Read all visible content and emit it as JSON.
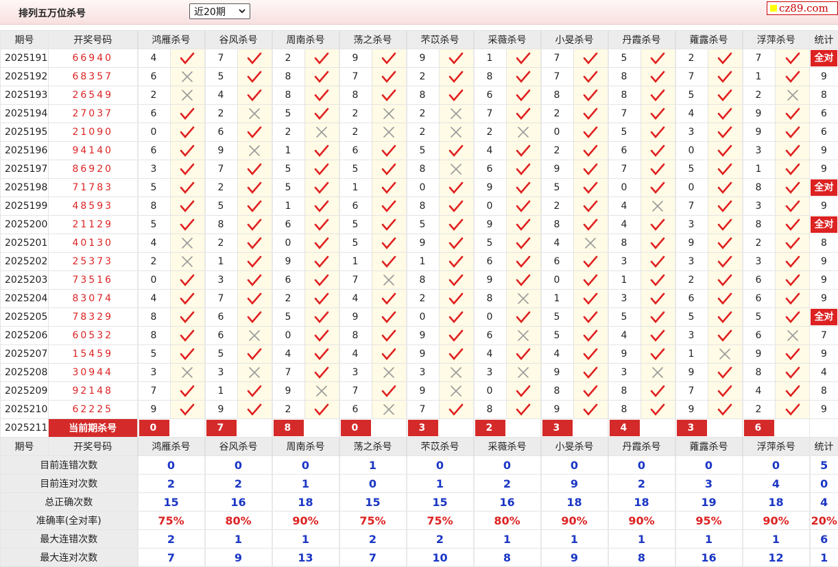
{
  "header": {
    "title": "排列五万位杀号",
    "period_select": "近20期",
    "logo": "cz89.com"
  },
  "columns": {
    "period": "期号",
    "number": "开奖号码",
    "experts": [
      "鸿雁杀号",
      "谷风杀号",
      "周南杀号",
      "荡之杀号",
      "芣苡杀号",
      "采薇杀号",
      "小旻杀号",
      "丹霞杀号",
      "蕹露杀号",
      "浮萍杀号"
    ],
    "stat": "统计"
  },
  "rows": [
    {
      "period": "2025191",
      "number": "66940",
      "kills": [
        [
          4,
          1
        ],
        [
          7,
          1
        ],
        [
          2,
          1
        ],
        [
          9,
          1
        ],
        [
          9,
          1
        ],
        [
          1,
          1
        ],
        [
          7,
          1
        ],
        [
          5,
          1
        ],
        [
          2,
          1
        ],
        [
          7,
          1
        ]
      ],
      "stat": "全对"
    },
    {
      "period": "2025192",
      "number": "68357",
      "kills": [
        [
          6,
          0
        ],
        [
          5,
          1
        ],
        [
          8,
          1
        ],
        [
          7,
          1
        ],
        [
          2,
          1
        ],
        [
          8,
          1
        ],
        [
          7,
          1
        ],
        [
          8,
          1
        ],
        [
          7,
          1
        ],
        [
          1,
          1
        ]
      ],
      "stat": "9"
    },
    {
      "period": "2025193",
      "number": "26549",
      "kills": [
        [
          2,
          0
        ],
        [
          4,
          1
        ],
        [
          8,
          1
        ],
        [
          8,
          1
        ],
        [
          8,
          1
        ],
        [
          6,
          1
        ],
        [
          8,
          1
        ],
        [
          8,
          1
        ],
        [
          5,
          1
        ],
        [
          2,
          0
        ]
      ],
      "stat": "8"
    },
    {
      "period": "2025194",
      "number": "27037",
      "kills": [
        [
          6,
          1
        ],
        [
          2,
          0
        ],
        [
          5,
          1
        ],
        [
          2,
          0
        ],
        [
          2,
          0
        ],
        [
          7,
          1
        ],
        [
          2,
          1
        ],
        [
          7,
          1
        ],
        [
          4,
          1
        ],
        [
          9,
          1
        ]
      ],
      "stat": "6"
    },
    {
      "period": "2025195",
      "number": "21090",
      "kills": [
        [
          0,
          1
        ],
        [
          6,
          1
        ],
        [
          2,
          0
        ],
        [
          2,
          0
        ],
        [
          2,
          0
        ],
        [
          2,
          0
        ],
        [
          0,
          1
        ],
        [
          5,
          1
        ],
        [
          3,
          1
        ],
        [
          9,
          1
        ]
      ],
      "stat": "6"
    },
    {
      "period": "2025196",
      "number": "94140",
      "kills": [
        [
          6,
          1
        ],
        [
          9,
          0
        ],
        [
          1,
          1
        ],
        [
          6,
          1
        ],
        [
          5,
          1
        ],
        [
          4,
          1
        ],
        [
          2,
          1
        ],
        [
          6,
          1
        ],
        [
          0,
          1
        ],
        [
          3,
          1
        ]
      ],
      "stat": "9"
    },
    {
      "period": "2025197",
      "number": "86920",
      "kills": [
        [
          3,
          1
        ],
        [
          7,
          1
        ],
        [
          5,
          1
        ],
        [
          5,
          1
        ],
        [
          8,
          0
        ],
        [
          6,
          1
        ],
        [
          9,
          1
        ],
        [
          7,
          1
        ],
        [
          5,
          1
        ],
        [
          1,
          1
        ]
      ],
      "stat": "9"
    },
    {
      "period": "2025198",
      "number": "71783",
      "kills": [
        [
          5,
          1
        ],
        [
          2,
          1
        ],
        [
          5,
          1
        ],
        [
          1,
          1
        ],
        [
          0,
          1
        ],
        [
          9,
          1
        ],
        [
          5,
          1
        ],
        [
          0,
          1
        ],
        [
          0,
          1
        ],
        [
          8,
          1
        ]
      ],
      "stat": "全对"
    },
    {
      "period": "2025199",
      "number": "48593",
      "kills": [
        [
          8,
          1
        ],
        [
          5,
          1
        ],
        [
          1,
          1
        ],
        [
          6,
          1
        ],
        [
          8,
          1
        ],
        [
          0,
          1
        ],
        [
          2,
          1
        ],
        [
          4,
          0
        ],
        [
          7,
          1
        ],
        [
          3,
          1
        ]
      ],
      "stat": "9"
    },
    {
      "period": "2025200",
      "number": "21129",
      "kills": [
        [
          5,
          1
        ],
        [
          8,
          1
        ],
        [
          6,
          1
        ],
        [
          5,
          1
        ],
        [
          5,
          1
        ],
        [
          9,
          1
        ],
        [
          8,
          1
        ],
        [
          4,
          1
        ],
        [
          3,
          1
        ],
        [
          8,
          1
        ]
      ],
      "stat": "全对"
    },
    {
      "period": "2025201",
      "number": "40130",
      "kills": [
        [
          4,
          0
        ],
        [
          2,
          1
        ],
        [
          0,
          1
        ],
        [
          5,
          1
        ],
        [
          9,
          1
        ],
        [
          5,
          1
        ],
        [
          4,
          0
        ],
        [
          8,
          1
        ],
        [
          9,
          1
        ],
        [
          2,
          1
        ]
      ],
      "stat": "8"
    },
    {
      "period": "2025202",
      "number": "25373",
      "kills": [
        [
          2,
          0
        ],
        [
          1,
          1
        ],
        [
          9,
          1
        ],
        [
          1,
          1
        ],
        [
          1,
          1
        ],
        [
          6,
          1
        ],
        [
          6,
          1
        ],
        [
          3,
          1
        ],
        [
          3,
          1
        ],
        [
          3,
          1
        ]
      ],
      "stat": "9"
    },
    {
      "period": "2025203",
      "number": "73516",
      "kills": [
        [
          0,
          1
        ],
        [
          3,
          1
        ],
        [
          6,
          1
        ],
        [
          7,
          0
        ],
        [
          8,
          1
        ],
        [
          9,
          1
        ],
        [
          0,
          1
        ],
        [
          1,
          1
        ],
        [
          2,
          1
        ],
        [
          6,
          1
        ]
      ],
      "stat": "9"
    },
    {
      "period": "2025204",
      "number": "83074",
      "kills": [
        [
          4,
          1
        ],
        [
          7,
          1
        ],
        [
          2,
          1
        ],
        [
          4,
          1
        ],
        [
          2,
          1
        ],
        [
          8,
          0
        ],
        [
          1,
          1
        ],
        [
          3,
          1
        ],
        [
          6,
          1
        ],
        [
          6,
          1
        ]
      ],
      "stat": "9"
    },
    {
      "period": "2025205",
      "number": "78329",
      "kills": [
        [
          8,
          1
        ],
        [
          6,
          1
        ],
        [
          5,
          1
        ],
        [
          9,
          1
        ],
        [
          0,
          1
        ],
        [
          0,
          1
        ],
        [
          5,
          1
        ],
        [
          5,
          1
        ],
        [
          5,
          1
        ],
        [
          5,
          1
        ]
      ],
      "stat": "全对"
    },
    {
      "period": "2025206",
      "number": "60532",
      "kills": [
        [
          8,
          1
        ],
        [
          6,
          0
        ],
        [
          0,
          1
        ],
        [
          8,
          1
        ],
        [
          9,
          1
        ],
        [
          6,
          0
        ],
        [
          5,
          1
        ],
        [
          4,
          1
        ],
        [
          3,
          1
        ],
        [
          6,
          0
        ]
      ],
      "stat": "7"
    },
    {
      "period": "2025207",
      "number": "15459",
      "kills": [
        [
          5,
          1
        ],
        [
          5,
          1
        ],
        [
          4,
          1
        ],
        [
          4,
          1
        ],
        [
          9,
          1
        ],
        [
          4,
          1
        ],
        [
          4,
          1
        ],
        [
          9,
          1
        ],
        [
          1,
          0
        ],
        [
          9,
          1
        ]
      ],
      "stat": "9"
    },
    {
      "period": "2025208",
      "number": "30944",
      "kills": [
        [
          3,
          0
        ],
        [
          3,
          0
        ],
        [
          7,
          1
        ],
        [
          3,
          0
        ],
        [
          3,
          0
        ],
        [
          3,
          0
        ],
        [
          9,
          1
        ],
        [
          3,
          0
        ],
        [
          9,
          1
        ],
        [
          8,
          1
        ]
      ],
      "stat": "4"
    },
    {
      "period": "2025209",
      "number": "92148",
      "kills": [
        [
          7,
          1
        ],
        [
          1,
          1
        ],
        [
          9,
          0
        ],
        [
          7,
          1
        ],
        [
          9,
          0
        ],
        [
          0,
          1
        ],
        [
          8,
          1
        ],
        [
          8,
          1
        ],
        [
          7,
          1
        ],
        [
          4,
          1
        ]
      ],
      "stat": "8"
    },
    {
      "period": "2025210",
      "number": "62225",
      "kills": [
        [
          9,
          1
        ],
        [
          9,
          1
        ],
        [
          2,
          1
        ],
        [
          6,
          0
        ],
        [
          7,
          1
        ],
        [
          8,
          1
        ],
        [
          9,
          1
        ],
        [
          8,
          1
        ],
        [
          9,
          1
        ],
        [
          2,
          1
        ]
      ],
      "stat": "9"
    }
  ],
  "current": {
    "period": "2025211",
    "label": "当前期杀号",
    "kills": [
      "0",
      "7",
      "8",
      "0",
      "3",
      "2",
      "3",
      "4",
      "3",
      "6"
    ]
  },
  "summary": [
    {
      "label": "目前连错次数",
      "values": [
        "0",
        "0",
        "0",
        "1",
        "0",
        "0",
        "0",
        "0",
        "0",
        "0"
      ],
      "stat": "5",
      "color": "blue"
    },
    {
      "label": "目前连对次数",
      "values": [
        "2",
        "2",
        "1",
        "0",
        "1",
        "2",
        "9",
        "2",
        "3",
        "4"
      ],
      "stat": "0",
      "color": "blue"
    },
    {
      "label": "总正确次数",
      "values": [
        "15",
        "16",
        "18",
        "15",
        "15",
        "16",
        "18",
        "18",
        "19",
        "18"
      ],
      "stat": "4",
      "color": "blue"
    },
    {
      "label": "准确率(全对率)",
      "values": [
        "75%",
        "80%",
        "90%",
        "75%",
        "75%",
        "80%",
        "90%",
        "90%",
        "95%",
        "90%"
      ],
      "stat": "20%",
      "color": "red"
    },
    {
      "label": "最大连错次数",
      "values": [
        "2",
        "1",
        "1",
        "2",
        "2",
        "1",
        "1",
        "1",
        "1",
        "1"
      ],
      "stat": "6",
      "color": "blue"
    },
    {
      "label": "最大连对次数",
      "values": [
        "7",
        "9",
        "13",
        "7",
        "10",
        "8",
        "9",
        "8",
        "16",
        "12"
      ],
      "stat": "1",
      "color": "blue"
    }
  ],
  "icons": {
    "correct": "check-icon",
    "wrong": "cross-icon",
    "correct_color": "#e02020",
    "wrong_color": "#9a9a9a"
  }
}
